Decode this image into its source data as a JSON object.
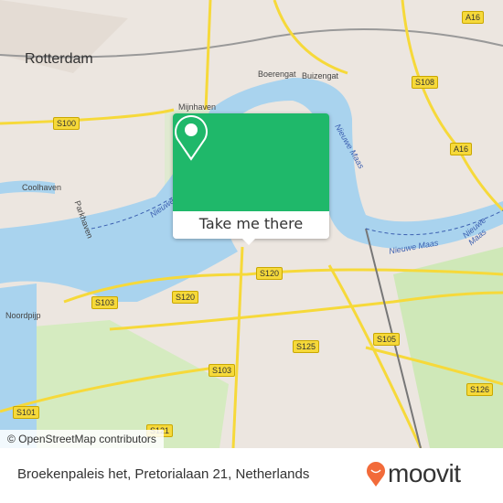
{
  "map": {
    "city_label": "Rotterdam",
    "street_labels": [
      "Boerengat",
      "Buizengat",
      "Mijnhaven",
      "Coolhaven",
      "Parkhaven",
      "Noordpijp"
    ],
    "water_labels": [
      "Nieuwe Maas",
      "Nieuwe Maas",
      "Nieuwe Maas",
      "Nieuwe Maas"
    ],
    "road_shields": [
      "S100",
      "S108",
      "A16",
      "A16",
      "S120",
      "S120",
      "S103",
      "S103",
      "S125",
      "S105",
      "S126",
      "S101",
      "S121"
    ],
    "colors": {
      "land": "#ece6e0",
      "water": "#a9d3ee",
      "road": "#f6d93a",
      "park": "#cfe8b8",
      "accent": "#1fb86a"
    }
  },
  "attribution": "© OpenStreetMap contributors",
  "popup": {
    "icon": "map-pin-icon",
    "button_label": "Take me there"
  },
  "footer": {
    "address": "Broekenpaleis het, Pretorialaan 21, Netherlands",
    "logo_text": "moovit",
    "logo_color": "#f26b3a"
  }
}
